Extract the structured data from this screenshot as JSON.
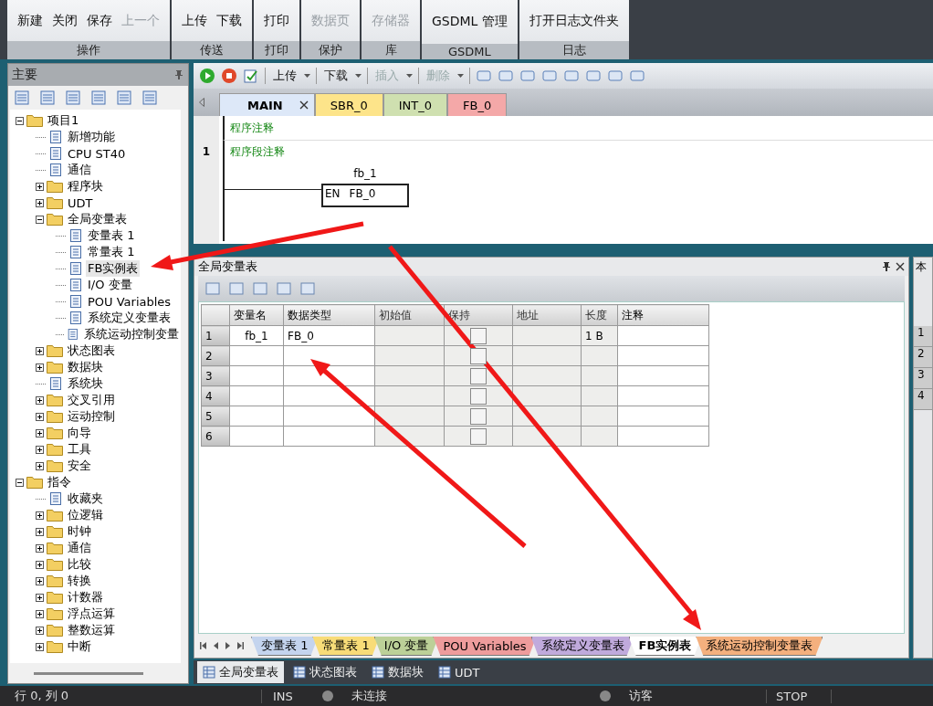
{
  "ribbon": {
    "groups": [
      {
        "label": "操作",
        "buttons": [
          {
            "label": "新建",
            "disabled": false
          },
          {
            "label": "关闭",
            "disabled": false
          },
          {
            "label": "保存",
            "disabled": false
          },
          {
            "label": "上一个",
            "disabled": true
          }
        ]
      },
      {
        "label": "传送",
        "buttons": [
          {
            "label": "上传",
            "disabled": false
          },
          {
            "label": "下载",
            "disabled": false
          }
        ]
      },
      {
        "label": "打印",
        "buttons": [
          {
            "label": "打印",
            "disabled": false
          }
        ]
      },
      {
        "label": "保护",
        "buttons": [
          {
            "label": "数据页",
            "disabled": true
          }
        ]
      },
      {
        "label": "库",
        "buttons": [
          {
            "label": "存储器",
            "disabled": true
          }
        ]
      },
      {
        "label": "GSDML",
        "buttons": [
          {
            "label": "GSDML 管理",
            "disabled": false
          }
        ]
      },
      {
        "label": "日志",
        "buttons": [
          {
            "label": "打开日志文件夹",
            "disabled": false
          }
        ]
      }
    ]
  },
  "project_panel": {
    "title": "主要",
    "tree": [
      {
        "label": "项目1",
        "expanded": true,
        "selected": false,
        "children": [
          {
            "label": "新增功能",
            "selected": false
          },
          {
            "label": "CPU ST40",
            "selected": false
          },
          {
            "label": "通信",
            "selected": false
          },
          {
            "label": "程序块",
            "expanded": false,
            "selected": false
          },
          {
            "label": "UDT",
            "expanded": false,
            "selected": false
          },
          {
            "label": "全局变量表",
            "expanded": true,
            "selected": false,
            "children": [
              {
                "label": "变量表 1",
                "selected": false
              },
              {
                "label": "常量表 1",
                "selected": false
              },
              {
                "label": "FB实例表",
                "selected": true
              },
              {
                "label": "I/O 变量",
                "selected": false
              },
              {
                "label": "POU Variables",
                "selected": false
              },
              {
                "label": "系统定义变量表",
                "selected": false
              },
              {
                "label": "系统运动控制变量",
                "selected": false
              }
            ]
          },
          {
            "label": "状态图表",
            "expanded": false,
            "selected": false
          },
          {
            "label": "数据块",
            "expanded": false,
            "selected": false
          },
          {
            "label": "系统块",
            "selected": false
          },
          {
            "label": "交叉引用",
            "expanded": false,
            "selected": false
          },
          {
            "label": "运动控制",
            "expanded": false,
            "selected": false
          },
          {
            "label": "向导",
            "expanded": false,
            "selected": false
          },
          {
            "label": "工具",
            "expanded": false,
            "selected": false
          },
          {
            "label": "安全",
            "expanded": false,
            "selected": false
          }
        ]
      },
      {
        "label": "指令",
        "expanded": true,
        "selected": false,
        "children": [
          {
            "label": "收藏夹",
            "selected": false
          },
          {
            "label": "位逻辑",
            "expanded": false,
            "selected": false
          },
          {
            "label": "时钟",
            "expanded": false,
            "selected": false
          },
          {
            "label": "通信",
            "expanded": false,
            "selected": false
          },
          {
            "label": "比较",
            "expanded": false,
            "selected": false
          },
          {
            "label": "转换",
            "expanded": false,
            "selected": false
          },
          {
            "label": "计数器",
            "expanded": false,
            "selected": false
          },
          {
            "label": "浮点运算",
            "expanded": false,
            "selected": false
          },
          {
            "label": "整数运算",
            "expanded": false,
            "selected": false
          },
          {
            "label": "中断",
            "expanded": false,
            "selected": false
          }
        ]
      }
    ]
  },
  "editor_toolbar": [
    {
      "label": "上传",
      "disabled": false
    },
    {
      "label": "下载",
      "disabled": false
    },
    {
      "label": "插入",
      "disabled": true
    },
    {
      "label": "删除",
      "disabled": true
    }
  ],
  "editor_tabs": [
    {
      "label": "MAIN",
      "selected": true,
      "color": "#dde8f8"
    },
    {
      "label": "SBR_0",
      "selected": false,
      "color": "#fde48a"
    },
    {
      "label": "INT_0",
      "selected": false,
      "color": "#cfe0b0"
    },
    {
      "label": "FB_0",
      "selected": false,
      "color": "#f4a8a8"
    }
  ],
  "editor": {
    "program_comment": "程序注释",
    "network_number": "1",
    "network_comment": "程序段注释",
    "instance_name": "fb_1",
    "en_label": "EN",
    "block_name": "FB_0"
  },
  "variable_table": {
    "title": "全局变量表",
    "columns": [
      {
        "label": "变量名",
        "disabled": false
      },
      {
        "label": "数据类型",
        "disabled": false
      },
      {
        "label": "初始值",
        "disabled": true
      },
      {
        "label": "保持",
        "disabled": true
      },
      {
        "label": "地址",
        "disabled": true
      },
      {
        "label": "长度",
        "disabled": true
      },
      {
        "label": "注释",
        "disabled": false
      }
    ],
    "rows": [
      {
        "number": "1",
        "name": "fb_1",
        "data_type": "FB_0",
        "retain": false,
        "length": "1 B"
      },
      {
        "number": "2",
        "retain": false
      },
      {
        "number": "3",
        "retain": false
      },
      {
        "number": "4",
        "retain": false
      },
      {
        "number": "5",
        "retain": false
      },
      {
        "number": "6",
        "retain": false
      }
    ],
    "sheet_tabs": [
      {
        "label": "变量表 1",
        "selected": false,
        "color": "#c4d4ee"
      },
      {
        "label": "常量表 1",
        "selected": false,
        "color": "#f8dc78"
      },
      {
        "label": "I/O 变量",
        "selected": false,
        "color": "#bcd098"
      },
      {
        "label": "POU Variables",
        "selected": false,
        "color": "#ee9c9c"
      },
      {
        "label": "系统定义变量表",
        "selected": false,
        "color": "#c0aadc"
      },
      {
        "label": "FB实例表",
        "selected": true,
        "color": "#ffffff"
      },
      {
        "label": "系统运动控制变量表",
        "selected": false,
        "color": "#f4b07e"
      }
    ]
  },
  "side_panel": {
    "title": "本",
    "row_numbers": [
      "1",
      "2",
      "3",
      "4"
    ]
  },
  "view_tabs": [
    {
      "label": "全局变量表",
      "selected": true
    },
    {
      "label": "状态图表",
      "selected": false
    },
    {
      "label": "数据块",
      "selected": false
    },
    {
      "label": "UDT",
      "selected": false
    }
  ],
  "status_bar": {
    "position": "行 0, 列 0",
    "mode": "INS",
    "connection": "未连接",
    "user": "访客",
    "cpu_state": "STOP"
  }
}
